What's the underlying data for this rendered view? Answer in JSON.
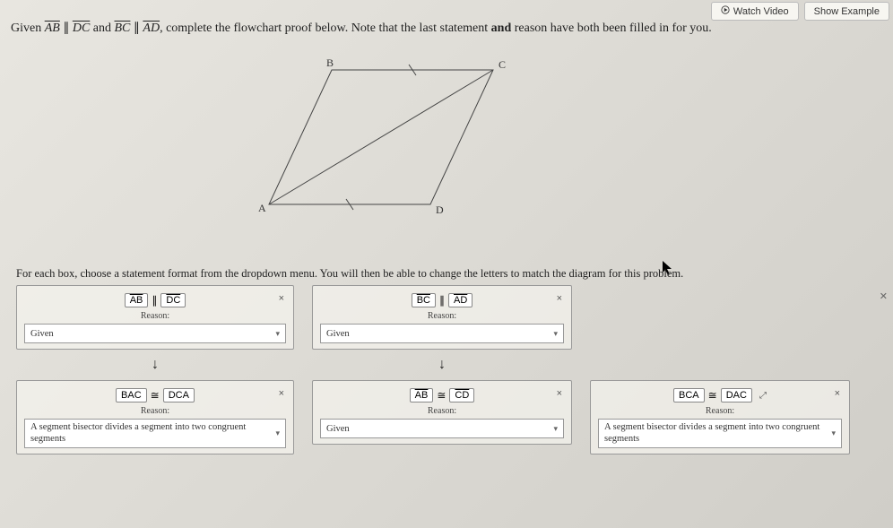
{
  "header": {
    "watch_video": "Watch Video",
    "show_example": "Show Example"
  },
  "prompt": {
    "given_word": "Given ",
    "seg1": "AB",
    "par": " ∥ ",
    "seg2": "DC",
    "and": " and ",
    "seg3": "BC",
    "seg4": "AD",
    "rest": ", complete the flowchart proof below. Note that the last statement ",
    "bold": "and",
    "rest2": " reason have both been filled in for you."
  },
  "diagram": {
    "A": "A",
    "B": "B",
    "C": "C",
    "D": "D"
  },
  "instruction": "For each box, choose a statement format from the dropdown menu. You will then be able to change the letters to match the diagram for this problem.",
  "close": "×",
  "parallel": "∥",
  "cong": "≅",
  "reason_label": "Reason:",
  "cards": {
    "c1": {
      "t1": "AB",
      "t2": "DC",
      "reason": "Given"
    },
    "c2": {
      "t1": "BC",
      "t2": "AD",
      "reason": "Given"
    },
    "c3": {
      "t1": "BAC",
      "t2": "DCA",
      "reason": "A segment bisector divides a segment into two congruent segments"
    },
    "c4": {
      "t1": "AB",
      "t2": "CD",
      "reason": "Given"
    },
    "c5": {
      "t1": "BCA",
      "t2": "DAC",
      "reason": "A segment bisector divides a segment into two congruent segments"
    }
  },
  "arrow": "↓"
}
